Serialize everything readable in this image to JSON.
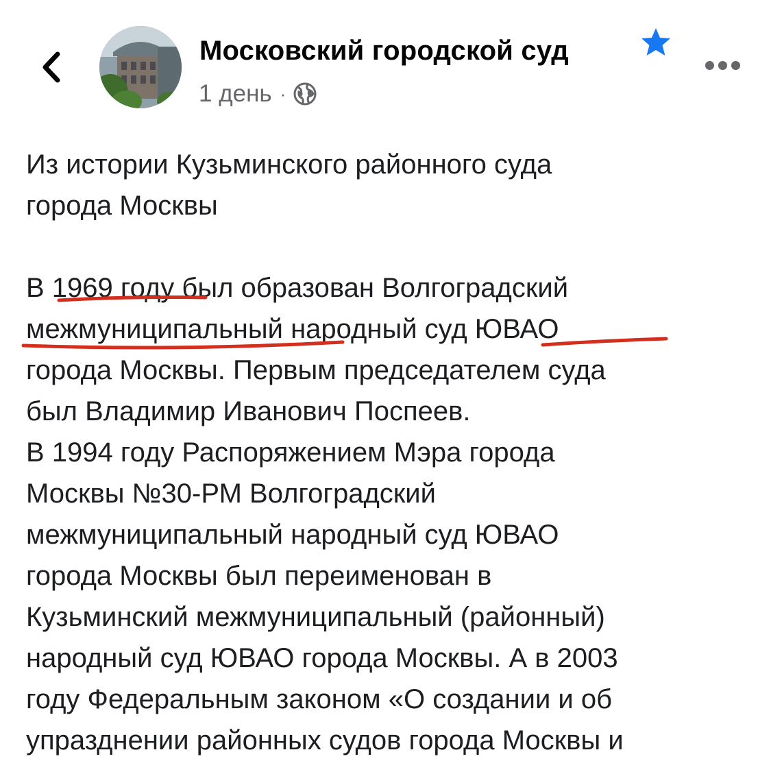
{
  "header": {
    "page_name": "Московский городской суд",
    "time": "1 день",
    "separator": "·",
    "privacy_icon": "globe-icon",
    "favorite_icon": "star-icon",
    "back_icon": "chevron-left-icon",
    "more_icon": "more-horizontal-icon"
  },
  "post": {
    "title_lines": [
      "Из истории Кузьминского районного суда",
      "города Москвы"
    ],
    "body_lines": [
      "В 1969 году был образован Волгоградский",
      "межмуниципальный народный суд ЮВАО",
      "города Москвы. Первым председателем суда",
      "был Владимир Иванович Поспеев.",
      "В 1994 году Распоряжением Мэра города",
      "Москвы №30-РМ Волгоградский",
      "межмуниципальный народный суд ЮВАО",
      "города Москвы был переименован в",
      "Кузьминский межмуниципальный (районный)",
      "народный суд ЮВАО города Москвы. А в 2003",
      "году Федеральным законом «О создании и об",
      "упразднении районных судов города Москвы и"
    ]
  },
  "colors": {
    "star": "#1877f2",
    "annotation": "#d32f1e",
    "secondary_text": "#65676b"
  }
}
